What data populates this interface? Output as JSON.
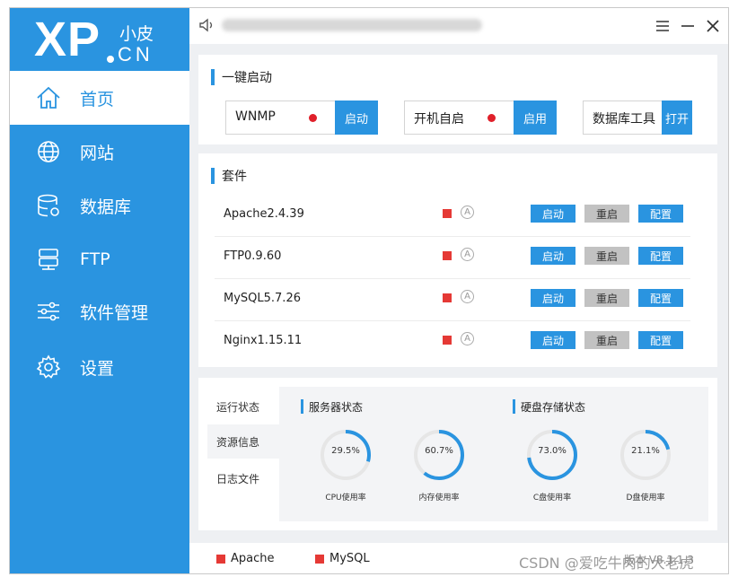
{
  "brand": {
    "logo_main": "XP",
    "logo_top": "小皮",
    "logo_bottom": "CN"
  },
  "sidebar": {
    "items": [
      {
        "label": "首页",
        "icon": "home-icon",
        "active": true
      },
      {
        "label": "网站",
        "icon": "globe-icon"
      },
      {
        "label": "数据库",
        "icon": "database-icon"
      },
      {
        "label": "FTP",
        "icon": "server-icon"
      },
      {
        "label": "软件管理",
        "icon": "sliders-icon"
      },
      {
        "label": "设置",
        "icon": "gear-icon"
      }
    ]
  },
  "titlebar": {
    "icons": [
      "speaker-icon",
      "menu-icon",
      "minimize-icon",
      "close-icon"
    ]
  },
  "quick_start": {
    "title": "一键启动",
    "boxes": [
      {
        "name": "WNMP",
        "status_color": "#e0202a",
        "button": "启动"
      },
      {
        "name": "开机自启",
        "status_color": "#e0202a",
        "button": "启用"
      },
      {
        "name": "数据库工具",
        "button": "打开"
      }
    ]
  },
  "suite": {
    "title": "套件",
    "rows": [
      {
        "name": "Apache2.4.39",
        "auto": "A",
        "start": "启动",
        "restart": "重启",
        "config": "配置"
      },
      {
        "name": "FTP0.9.60",
        "auto": "A",
        "start": "启动",
        "restart": "重启",
        "config": "配置"
      },
      {
        "name": "MySQL5.7.26",
        "auto": "A",
        "start": "启动",
        "restart": "重启",
        "config": "配置"
      },
      {
        "name": "Nginx1.15.11",
        "auto": "A",
        "start": "启动",
        "restart": "重启",
        "config": "配置"
      }
    ]
  },
  "info_tabs": [
    "运行状态",
    "资源信息",
    "日志文件"
  ],
  "info_active_tab": 1,
  "server_status": {
    "title": "服务器状态",
    "gauges": [
      {
        "value": 29.5,
        "text": "29.5%",
        "label": "CPU使用率"
      },
      {
        "value": 60.7,
        "text": "60.7%",
        "label": "内存使用率"
      }
    ]
  },
  "disk_status": {
    "title": "硬盘存储状态",
    "gauges": [
      {
        "value": 73.0,
        "text": "73.0%",
        "label": "C盘使用率"
      },
      {
        "value": 21.1,
        "text": "21.1%",
        "label": "D盘使用率"
      }
    ]
  },
  "statusbar": {
    "items": [
      {
        "label": "Apache",
        "color": "#e53935"
      },
      {
        "label": "MySQL",
        "color": "#e53935"
      }
    ],
    "version": "版本 V8.1.1.3"
  },
  "watermark": "CSDN @爱吃牛肉的大老虎",
  "colors": {
    "accent": "#2a94e0",
    "stopped": "#e53935",
    "gauge_track": "#e6e6e6"
  }
}
